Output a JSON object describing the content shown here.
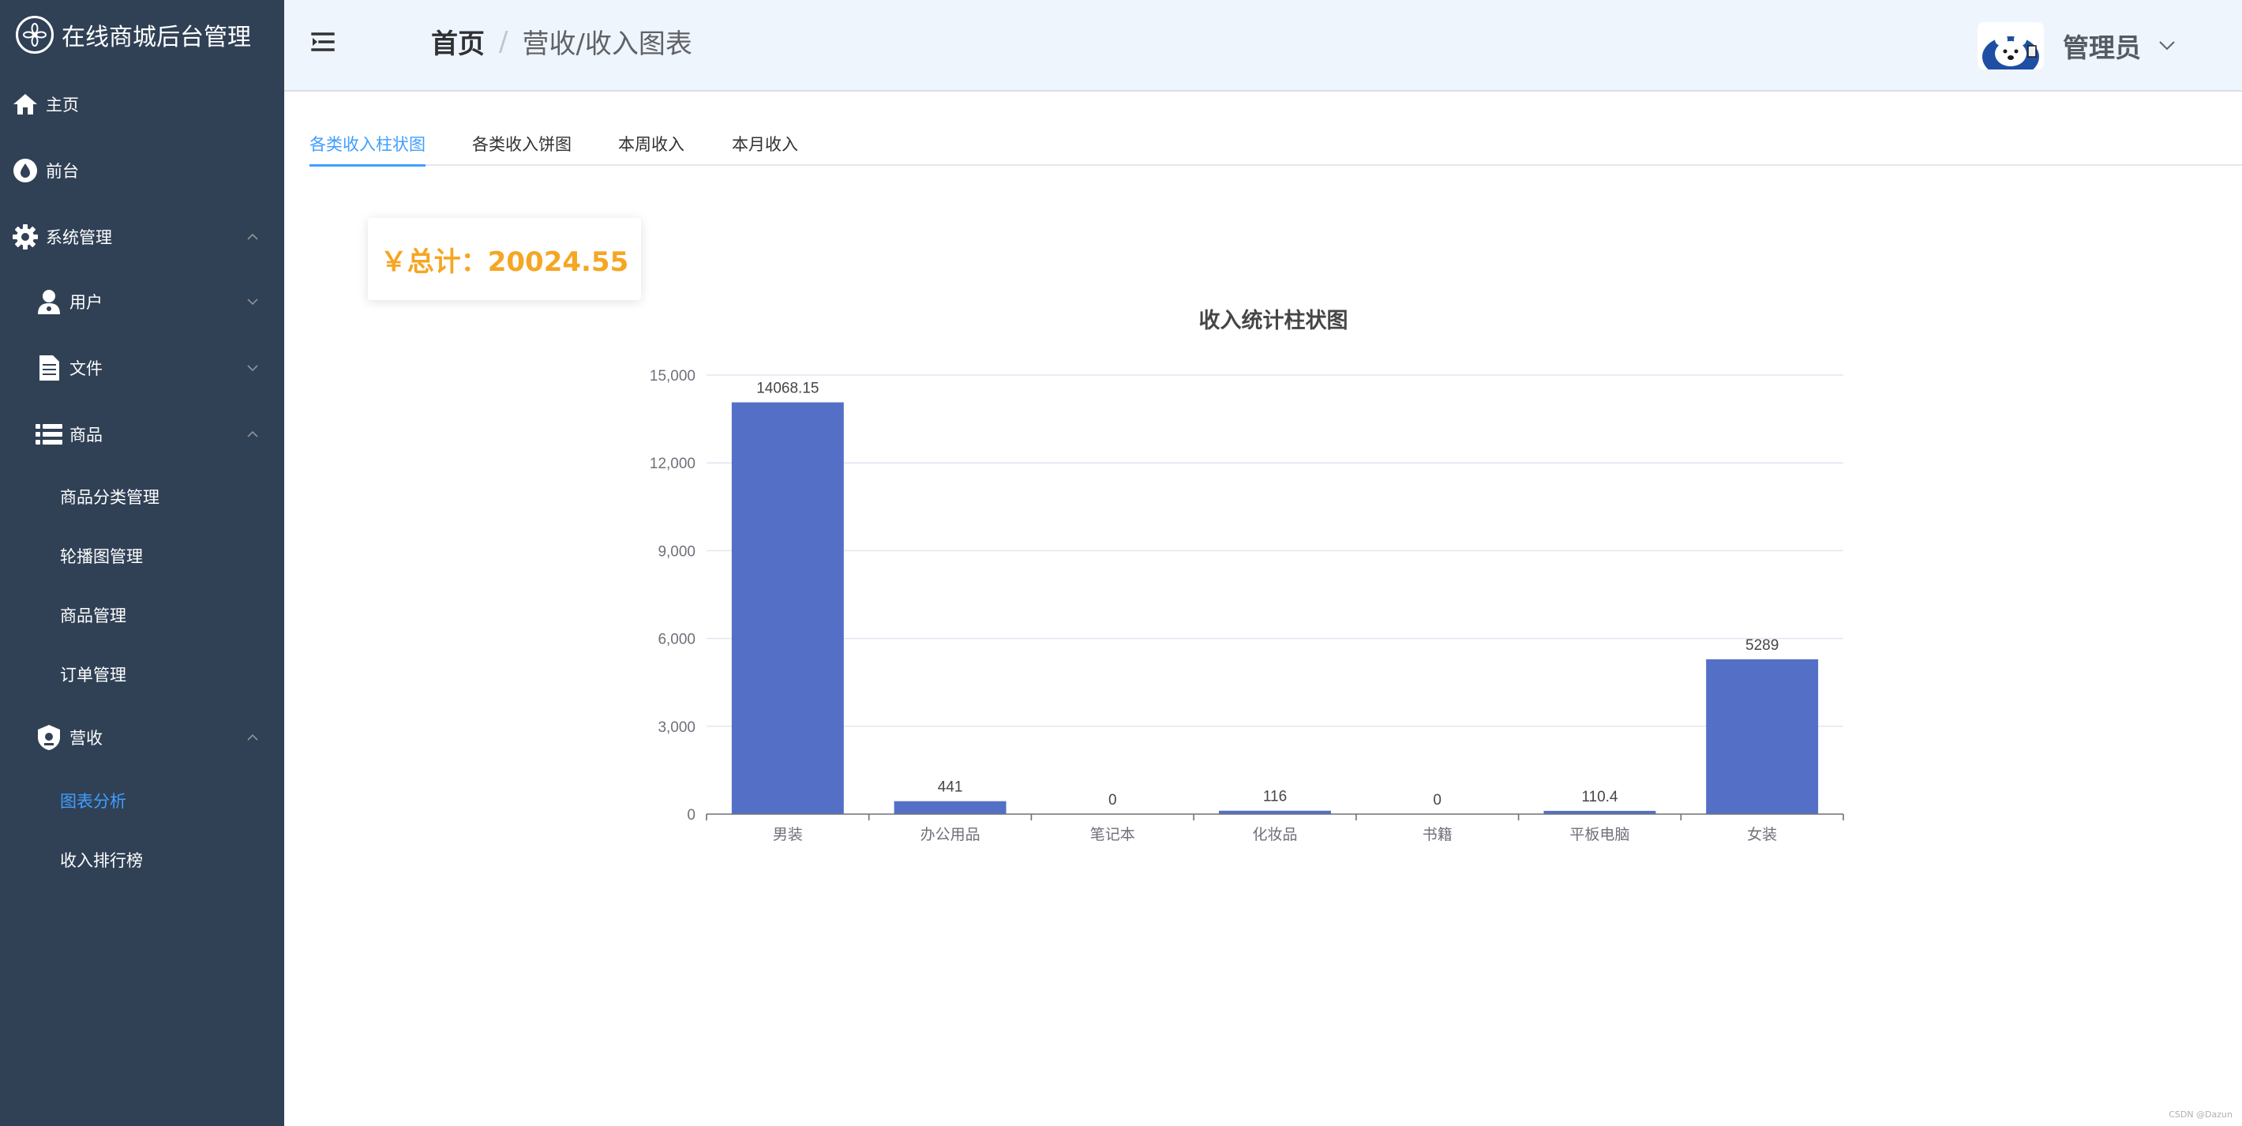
{
  "brand": {
    "title": "在线商城后台管理",
    "logo_icon": "flower-logo-icon"
  },
  "sidebar": {
    "items": [
      {
        "label": "主页",
        "icon": "home-icon"
      },
      {
        "label": "前台",
        "icon": "drop-icon"
      },
      {
        "label": "系统管理",
        "icon": "gear-icon",
        "expanded": true
      },
      {
        "label": "用户",
        "icon": "user-icon",
        "expanded": false
      },
      {
        "label": "文件",
        "icon": "document-icon",
        "expanded": false
      },
      {
        "label": "商品",
        "icon": "list-icon",
        "expanded": true
      },
      {
        "label": "营收",
        "icon": "badge-icon",
        "expanded": true
      }
    ],
    "goods_sub": [
      "商品分类管理",
      "轮播图管理",
      "商品管理",
      "订单管理"
    ],
    "income_sub": [
      "图表分析",
      "收入排行榜"
    ],
    "active_sub": "图表分析",
    "colors": {
      "bg": "#304156",
      "active": "#409eff"
    }
  },
  "header": {
    "breadcrumb_home": "首页",
    "breadcrumb_sep": "/",
    "breadcrumb_current": "营收/收入图表",
    "user_name": "管理员"
  },
  "tabs": {
    "items": [
      "各类收入柱状图",
      "各类收入饼图",
      "本周收入",
      "本月收入"
    ],
    "active_index": 0
  },
  "total": {
    "text": "￥总计：20024.55"
  },
  "chart_data": {
    "type": "bar",
    "title": "收入统计柱状图",
    "categories": [
      "男装",
      "办公用品",
      "笔记本",
      "化妆品",
      "书籍",
      "平板电脑",
      "女装"
    ],
    "values": [
      14068.15,
      441,
      0,
      116,
      0,
      110.4,
      5289
    ],
    "value_labels": [
      "14068.15",
      "441",
      "0",
      "116",
      "0",
      "110.4",
      "5289"
    ],
    "ylim": [
      0,
      15000
    ],
    "yticks": [
      "0",
      "3,000",
      "6,000",
      "9,000",
      "12,000",
      "15,000"
    ],
    "grid": true,
    "bar_color": "#5470c6"
  },
  "watermark": "CSDN @Dazun"
}
